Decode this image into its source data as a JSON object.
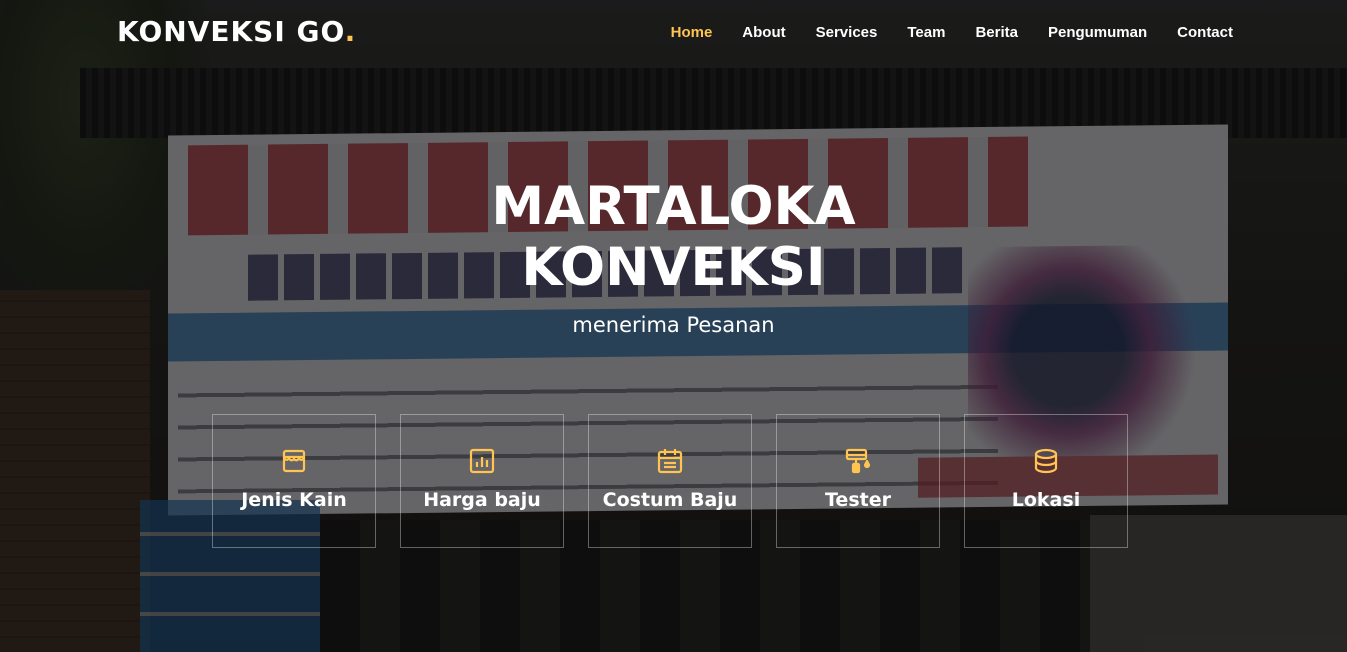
{
  "brand": {
    "name": "KONVEKSI GO",
    "dot": ".",
    "accent": "#ffc451"
  },
  "nav": {
    "items": [
      {
        "label": "Home",
        "active": true
      },
      {
        "label": "About"
      },
      {
        "label": "Services"
      },
      {
        "label": "Team"
      },
      {
        "label": "Berita"
      },
      {
        "label": "Pengumuman"
      },
      {
        "label": "Contact"
      }
    ]
  },
  "hero": {
    "title_line1": "MARTALOKA",
    "title_line2": "KONVEKSI",
    "subtitle": "menerima Pesanan"
  },
  "features": [
    {
      "label": "Jenis Kain",
      "icon": "store-icon"
    },
    {
      "label": "Harga baju",
      "icon": "bar-chart-icon"
    },
    {
      "label": "Costum Baju",
      "icon": "calendar-icon"
    },
    {
      "label": "Tester",
      "icon": "paint-bucket-icon"
    },
    {
      "label": "Lokasi",
      "icon": "database-icon"
    }
  ]
}
